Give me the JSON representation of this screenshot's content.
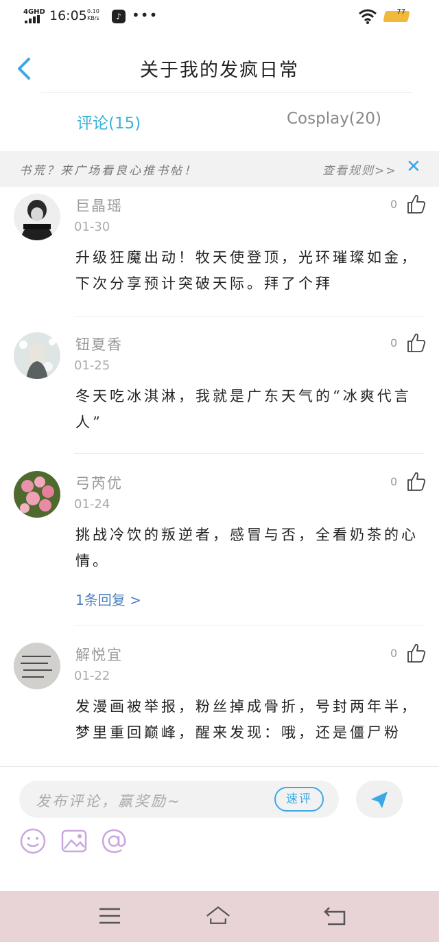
{
  "status_bar": {
    "network": "4GHD",
    "time": "16:05",
    "speed_value": "0.10",
    "speed_unit": "KB/s",
    "more": "•••",
    "battery": "77"
  },
  "header": {
    "title": "关于我的发疯日常"
  },
  "tabs": [
    {
      "label": "评论(15)"
    },
    {
      "label": "Cosplay(20)"
    }
  ],
  "notice": {
    "text": "书荒？来广场看良心推书帖！",
    "rules_link": "查看规则>>",
    "close": "✕"
  },
  "comments": [
    {
      "name": "巨晶瑶",
      "date": "01-30",
      "likes": "0",
      "text": "升级狂魔出动！牧天使登顶，光环璀璨如金，下次分享预计突破天际。拜了个拜"
    },
    {
      "name": "钮夏香",
      "date": "01-25",
      "likes": "0",
      "text": "冬天吃冰淇淋，我就是广东天气的“冰爽代言人”"
    },
    {
      "name": "弓芮优",
      "date": "01-24",
      "likes": "0",
      "text": "挑战冷饮的叛逆者，感冒与否，全看奶茶的心情。",
      "reply": "1条回复 >"
    },
    {
      "name": "解悦宜",
      "date": "01-22",
      "likes": "0",
      "text": "发漫画被举报，粉丝掉成骨折，号封两年半，梦里重回巅峰，醒来发现：哦，还是僵尸粉"
    }
  ],
  "input": {
    "placeholder": "发布评论，赢奖励~",
    "quick_button": "速评"
  },
  "colors": {
    "accent": "#3aa8e6",
    "active_tab": "#3ab0d8",
    "navbar": "#e8d3d6",
    "tool_icons": "#c9a6e0"
  },
  "icons": [
    "back-icon",
    "thumb-up-icon",
    "send-icon",
    "emoji-icon",
    "image-icon",
    "mention-icon",
    "menu-icon",
    "home-icon",
    "back-nav-icon"
  ]
}
